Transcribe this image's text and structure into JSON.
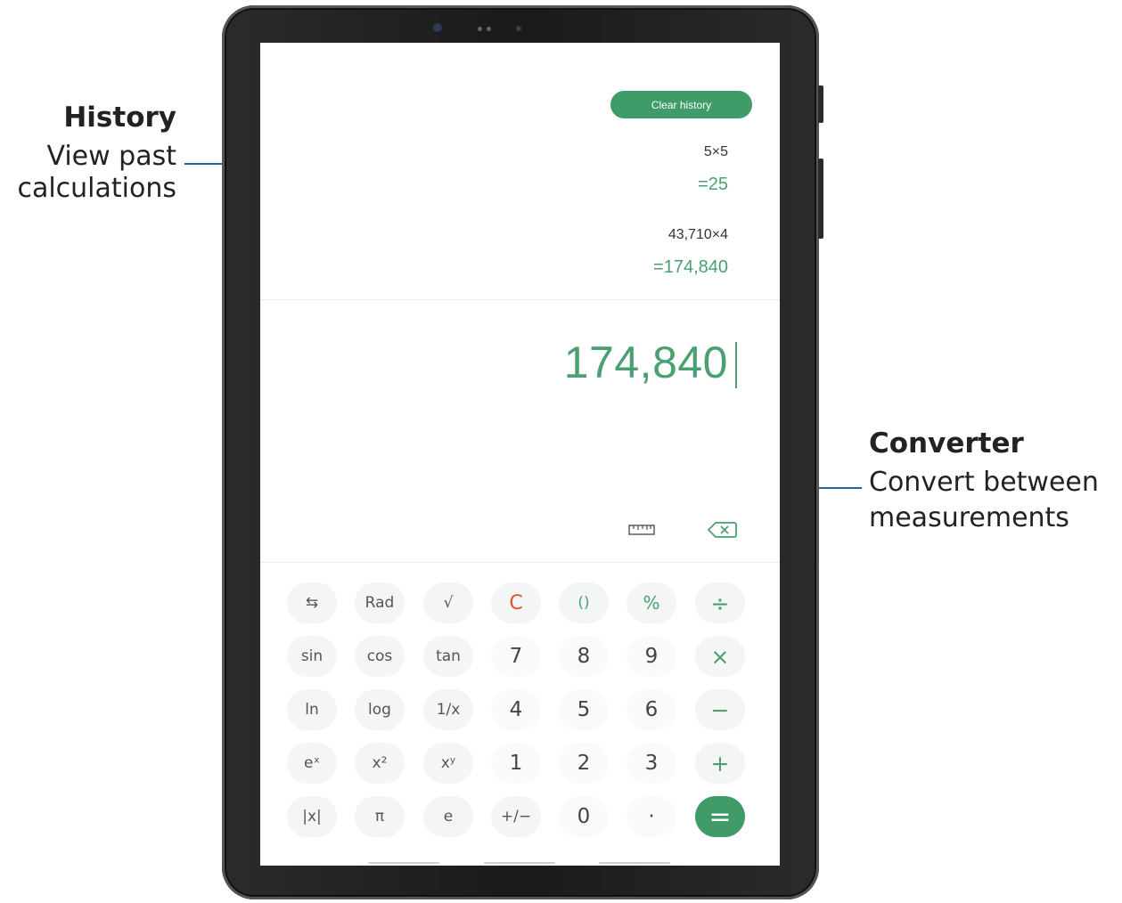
{
  "callouts": {
    "history": {
      "title": "History",
      "desc_line1": "View past",
      "desc_line2": "calculations"
    },
    "converter": {
      "title": "Converter",
      "desc_line1": "Convert between",
      "desc_line2": "measurements"
    }
  },
  "calculator": {
    "clear_history_label": "Clear history",
    "history": [
      {
        "expression": "5×5",
        "result": "=25"
      },
      {
        "expression": "43,710×4",
        "result": "=174,840"
      }
    ],
    "display_value": "174,840",
    "converter_icon": "ruler-icon",
    "backspace_icon": "backspace-icon"
  },
  "keypad": {
    "rows": [
      [
        "⇆",
        "Rad",
        "√",
        "C",
        "()",
        "%",
        "÷"
      ],
      [
        "sin",
        "cos",
        "tan",
        "7",
        "8",
        "9",
        "×"
      ],
      [
        "ln",
        "log",
        "1/x",
        "4",
        "5",
        "6",
        "−"
      ],
      [
        "eˣ",
        "x²",
        "xʸ",
        "1",
        "2",
        "3",
        "+"
      ],
      [
        "|x|",
        "π",
        "e",
        "+/−",
        "0",
        "·",
        "="
      ]
    ]
  },
  "colors": {
    "accent_green": "#3f9b68",
    "result_green": "#4aa070",
    "clear_red": "#e0542f",
    "leader_blue": "#1a6a99"
  }
}
